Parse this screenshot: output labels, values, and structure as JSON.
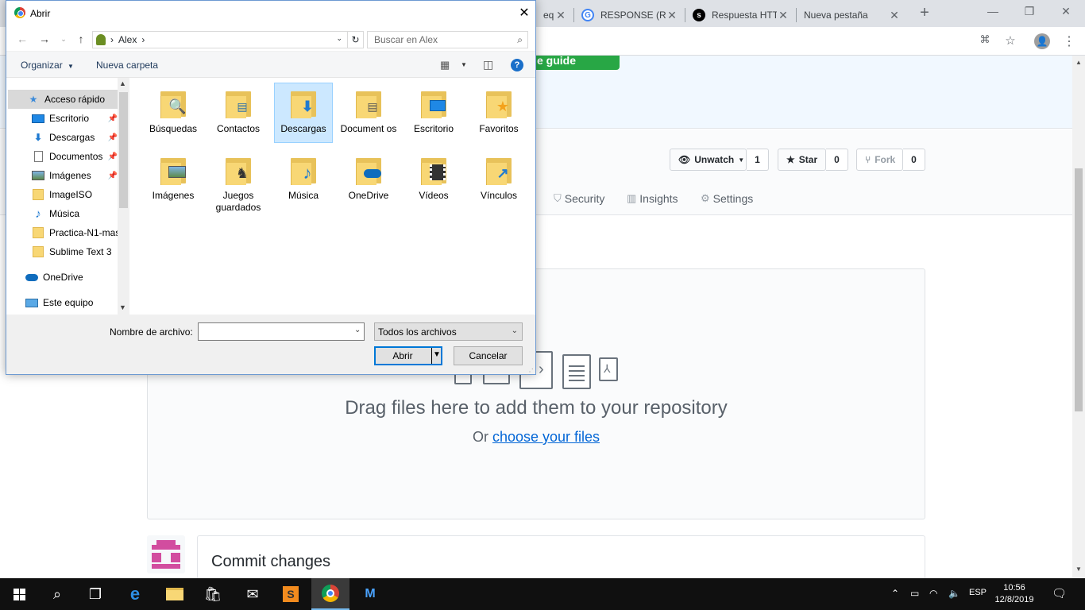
{
  "browser": {
    "tabs": [
      {
        "title": "equ",
        "icon": "github-icon"
      },
      {
        "title": "RESPONSE (RE",
        "icon": "google-icon"
      },
      {
        "title": "Respuesta HTT",
        "icon": "symfony-icon"
      },
      {
        "title": "Nueva pestaña",
        "icon": ""
      }
    ],
    "new_tab": "+",
    "avatar": "👤"
  },
  "github": {
    "green_button": "e guide",
    "unwatch": {
      "label": "Unwatch",
      "count": "1"
    },
    "star": {
      "label": "Star",
      "count": "0"
    },
    "fork": {
      "label": "Fork",
      "count": "0"
    },
    "tabs": [
      "Security",
      "Insights",
      "Settings"
    ],
    "drop_title": "Drag files here to add them to your repository",
    "drop_or": "Or",
    "drop_link": "choose your files",
    "commit_title": "Commit changes"
  },
  "dialog": {
    "title": "Abrir",
    "close": "✕",
    "address": {
      "path": "Alex",
      "separator": "›"
    },
    "search_placeholder": "Buscar en Alex",
    "commands": {
      "organize": "Organizar",
      "new_folder": "Nueva carpeta"
    },
    "help": "?",
    "sidebar": [
      {
        "label": "Acceso rápido",
        "icon": "star-icon",
        "pinned": false,
        "selected": true
      },
      {
        "label": "Escritorio",
        "icon": "desktop-icon",
        "pinned": true
      },
      {
        "label": "Descargas",
        "icon": "download-icon",
        "pinned": true
      },
      {
        "label": "Documentos",
        "icon": "document-icon",
        "pinned": true
      },
      {
        "label": "Imágenes",
        "icon": "image-icon",
        "pinned": true
      },
      {
        "label": "ImageISO",
        "icon": "folder-icon",
        "pinned": false
      },
      {
        "label": "Música",
        "icon": "music-icon",
        "pinned": false
      },
      {
        "label": "Practica-N1-mas",
        "icon": "folder-icon",
        "pinned": false
      },
      {
        "label": "Sublime Text 3",
        "icon": "folder-icon",
        "pinned": false
      },
      {
        "label": "OneDrive",
        "icon": "onedrive-icon",
        "pinned": false
      },
      {
        "label": "Este equipo",
        "icon": "computer-icon",
        "pinned": false
      }
    ],
    "folders": [
      {
        "name": "Búsquedas",
        "icon": "magnifier-icon",
        "selected": false
      },
      {
        "name": "Contactos",
        "icon": "contact-card-icon",
        "selected": false
      },
      {
        "name": "Descargas",
        "icon": "download-arrow-icon",
        "selected": true
      },
      {
        "name": "Document os",
        "icon": "document-icon",
        "selected": false
      },
      {
        "name": "Escritorio",
        "icon": "desktop-icon",
        "selected": false
      },
      {
        "name": "Favoritos",
        "icon": "star-icon",
        "selected": false
      },
      {
        "name": "Imágenes",
        "icon": "landscape-icon",
        "selected": false
      },
      {
        "name": "Juegos guardados",
        "icon": "chess-icon",
        "selected": false
      },
      {
        "name": "Música",
        "icon": "music-note-icon",
        "selected": false
      },
      {
        "name": "OneDrive",
        "icon": "cloud-icon",
        "selected": false
      },
      {
        "name": "Vídeos",
        "icon": "film-icon",
        "selected": false
      },
      {
        "name": "Vínculos",
        "icon": "shortcut-arrow-icon",
        "selected": false
      }
    ],
    "filename_label": "Nombre de archivo:",
    "filename_value": "",
    "filter": "Todos los archivos",
    "open_button": "Abrir",
    "cancel_button": "Cancelar"
  },
  "taskbar": {
    "language": "ESP",
    "time": "10:56",
    "date": "12/8/2019"
  }
}
